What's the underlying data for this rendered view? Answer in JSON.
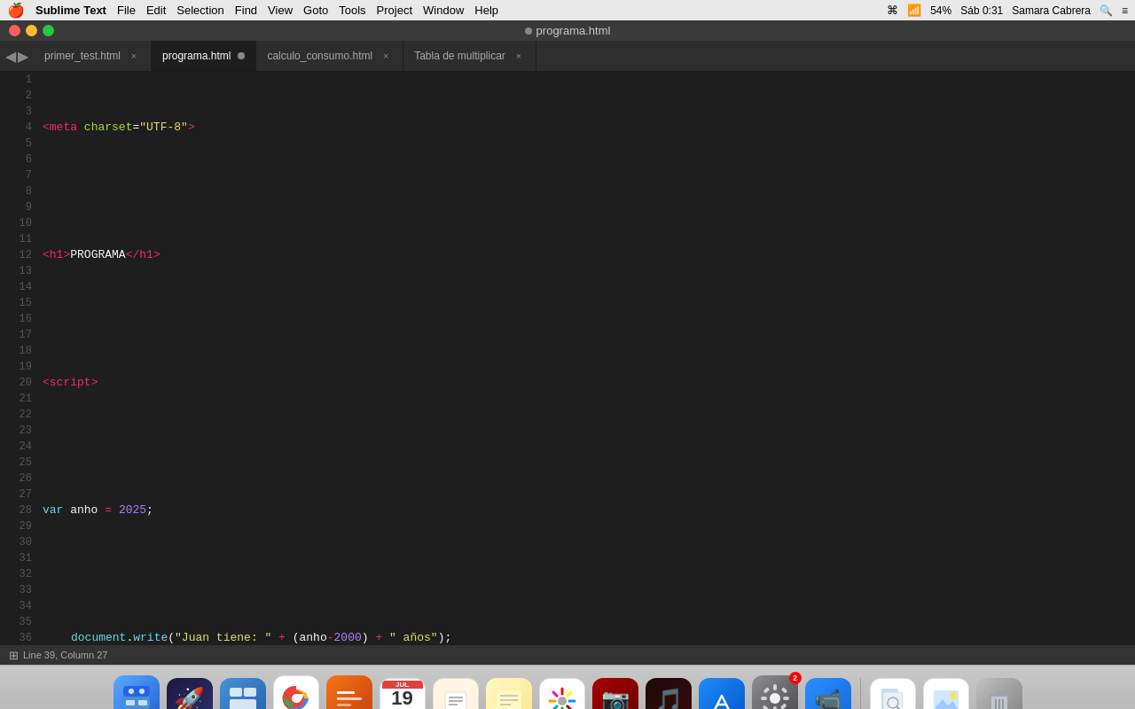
{
  "menubar": {
    "apple": "🍎",
    "items": [
      "Sublime Text",
      "File",
      "Edit",
      "Selection",
      "Find",
      "View",
      "Goto",
      "Tools",
      "Project",
      "Window",
      "Help"
    ],
    "right": {
      "siri": "⌘",
      "wifi": "WiFi",
      "battery": "54%",
      "time": "Sáb 0:31",
      "user": "Samara Cabrera",
      "search": "🔍",
      "list": "≡"
    }
  },
  "titlebar": {
    "title": "programa.html"
  },
  "tabs": [
    {
      "id": "tab1",
      "label": "primer_test.html",
      "active": false,
      "modified": false,
      "closeable": true
    },
    {
      "id": "tab2",
      "label": "programa.html",
      "active": true,
      "modified": true,
      "closeable": true
    },
    {
      "id": "tab3",
      "label": "calculo_consumo.html",
      "active": false,
      "modified": false,
      "closeable": true
    },
    {
      "id": "tab4",
      "label": "Tabla de multiplicar",
      "active": false,
      "modified": false,
      "closeable": true
    }
  ],
  "statusbar": {
    "line_col": "Line 39, Column 27"
  },
  "dock": {
    "items": [
      {
        "id": "finder",
        "emoji": "🗂",
        "label": "Finder",
        "bg": "#4a90d9",
        "dot": true
      },
      {
        "id": "launchpad",
        "emoji": "🚀",
        "label": "Launchpad",
        "bg": "#1a1a2e",
        "dot": false
      },
      {
        "id": "mission",
        "emoji": "⊞",
        "label": "Mission Control",
        "bg": "#4a90d9",
        "dot": false
      },
      {
        "id": "chrome",
        "emoji": "🌐",
        "label": "Chrome",
        "bg": "#fff",
        "dot": true
      },
      {
        "id": "sublime",
        "emoji": "S",
        "label": "Sublime Text",
        "bg": "#f97316",
        "dot": true
      },
      {
        "id": "calendar",
        "emoji": "📅",
        "label": "Calendar",
        "bg": "#fff",
        "dot": false
      },
      {
        "id": "reminders",
        "emoji": "📋",
        "label": "Reminders",
        "bg": "#fff",
        "dot": false
      },
      {
        "id": "notes",
        "emoji": "📝",
        "label": "Notes",
        "bg": "#fef3c7",
        "dot": false
      },
      {
        "id": "photos",
        "emoji": "🌸",
        "label": "Photos",
        "bg": "#fff",
        "dot": false
      },
      {
        "id": "photobooth",
        "emoji": "📷",
        "label": "Photo Booth",
        "bg": "#1a1a1a",
        "dot": false
      },
      {
        "id": "music",
        "emoji": "🎵",
        "label": "Music",
        "bg": "#1a1a1a",
        "dot": false
      },
      {
        "id": "appstore",
        "emoji": "A",
        "label": "App Store",
        "bg": "#1d8cf8",
        "dot": false
      },
      {
        "id": "settings",
        "emoji": "⚙",
        "label": "System Preferences",
        "bg": "#8e8e93",
        "dot": false,
        "badge": "2"
      },
      {
        "id": "zoom",
        "emoji": "📹",
        "label": "Zoom",
        "bg": "#2d8cff",
        "dot": false
      },
      {
        "id": "preview",
        "emoji": "🖼",
        "label": "Preview",
        "bg": "#fff",
        "dot": false
      },
      {
        "id": "photos2",
        "emoji": "🌅",
        "label": "Photos Export",
        "bg": "#fff",
        "dot": false
      },
      {
        "id": "trash",
        "emoji": "🗑",
        "label": "Trash",
        "bg": "#9ca3af",
        "dot": false
      }
    ]
  }
}
